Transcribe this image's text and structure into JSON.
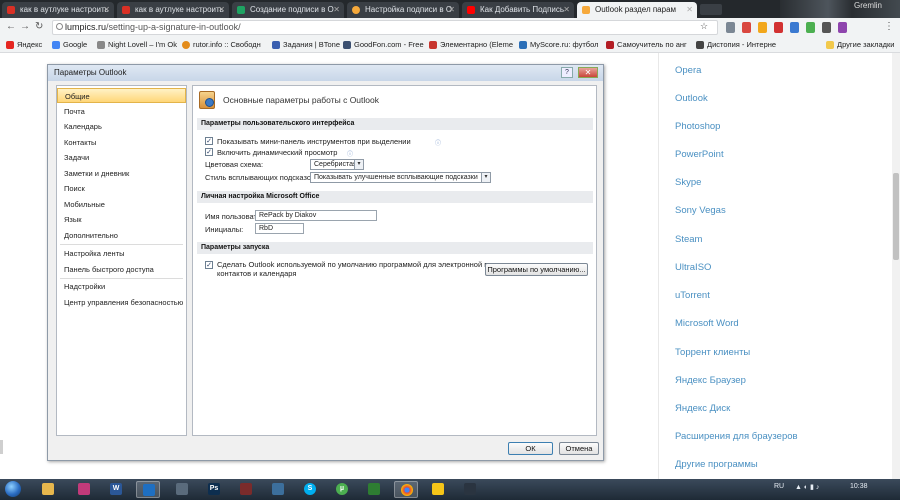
{
  "browser": {
    "tabs": [
      {
        "label": "как в аутлуке настроить",
        "color": "#d93025"
      },
      {
        "label": "как в аутлуке настроить",
        "color": "#d93025"
      },
      {
        "label": "Создание подписи в О",
        "color": "#1ea362"
      },
      {
        "label": "Настройка подписи в О",
        "color": "#f6a93b"
      },
      {
        "label": "Как Добавить Подпись",
        "color": "#ff0000"
      },
      {
        "label": "Outlook раздел парам",
        "color": "#f6a93b"
      }
    ],
    "profile_name": "Gremlin",
    "url_host": "lumpics.ru",
    "url_path": "/setting-up-a-signature-in-outlook/",
    "bookmarks": [
      {
        "label": "Яндекс",
        "color": "#e52620"
      },
      {
        "label": "Google",
        "color": "#4285f4"
      },
      {
        "label": "Night Lovell – I'm Ok",
        "color": "#888888"
      },
      {
        "label": "rutor.info :: Свободн",
        "color": "#e38c1b"
      },
      {
        "label": "Задания | BTone",
        "color": "#3a5fb0"
      },
      {
        "label": "GoodFon.com - Free",
        "color": "#3b4f70"
      },
      {
        "label": "Элементарно (Eleme",
        "color": "#c8352e"
      },
      {
        "label": "MyScore.ru: футбол",
        "color": "#2c6fb8"
      },
      {
        "label": "Самоучитель по анг",
        "color": "#b31d24"
      },
      {
        "label": "Дистопия - Интерне",
        "color": "#444444"
      }
    ],
    "other_bookmarks": "Другие закладки"
  },
  "page": {
    "side_links": [
      "Opera",
      "Outlook",
      "Photoshop",
      "PowerPoint",
      "Skype",
      "Sony Vegas",
      "Steam",
      "UltraISO",
      "uTorrent",
      "Microsoft Word",
      "Торрент клиенты",
      "Яндекс Браузер",
      "Яндекс Диск",
      "Расширения для браузеров",
      "Другие программы"
    ]
  },
  "dialog": {
    "title": "Параметры Outlook",
    "help_btn": "?",
    "close_btn": "✕",
    "nav": [
      "Общие",
      "Почта",
      "Календарь",
      "Контакты",
      "Задачи",
      "Заметки и дневник",
      "Поиск",
      "Мобильные",
      "Язык",
      "Дополнительно",
      "Настройка ленты",
      "Панель быстрого доступа",
      "Надстройки",
      "Центр управления безопасностью"
    ],
    "header": "Основные параметры работы с Outlook",
    "sections": {
      "ui": "Параметры пользовательского интерфейса",
      "personal": "Личная настройка Microsoft Office",
      "startup": "Параметры запуска"
    },
    "options": {
      "mini_toolbar": "Показывать мини-панель инструментов при выделении",
      "live_preview": "Включить динамический просмотр",
      "color_scheme_label": "Цветовая схема:",
      "color_scheme_value": "Серебристая",
      "tooltip_style_label": "Стиль всплывающих подсказок:",
      "tooltip_style_value": "Показывать улучшенные всплывающие подсказки",
      "username_label": "Имя пользователя:",
      "username_value": "RePack by Diakov",
      "initials_label": "Инициалы:",
      "initials_value": "RbD",
      "default_program_line1": "Сделать Outlook используемой по умолчанию программой для электронной почты,",
      "default_program_line2": "контактов и календаря",
      "default_programs_btn": "Программы по умолчанию..."
    },
    "ok_btn": "ОК",
    "cancel_btn": "Отмена"
  },
  "taskbar": {
    "lang": "RU",
    "time": "10:38"
  }
}
